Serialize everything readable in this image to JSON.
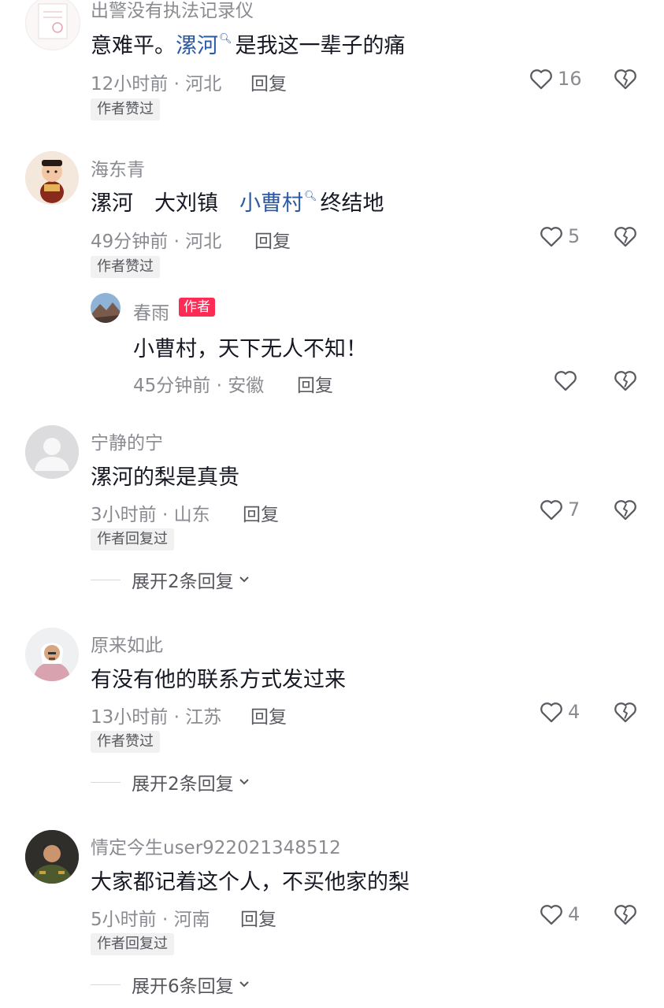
{
  "comments": [
    {
      "username": "出警没有执法记录仪",
      "text_parts": [
        "意难平。",
        "漯河",
        "是我这一辈子的痛"
      ],
      "time_location": "12小时前 · 河北",
      "reply_label": "回复",
      "likes": "16",
      "badge": "作者赞过"
    },
    {
      "username": "海东青",
      "text_parts": [
        "漯河　大刘镇　",
        "小曹村",
        "终结地"
      ],
      "time_location": "49分钟前 · 河北",
      "reply_label": "回复",
      "likes": "5",
      "badge": "作者赞过",
      "reply": {
        "username": "春雨",
        "author_tag": "作者",
        "text": "小曹村，天下无人不知！",
        "time_location": "45分钟前 · 安徽",
        "reply_label": "回复",
        "likes": ""
      }
    },
    {
      "username": "宁静的宁",
      "text": "漯河的梨是真贵",
      "time_location": "3小时前 · 山东",
      "reply_label": "回复",
      "likes": "7",
      "badge": "作者回复过",
      "expand_label": "展开2条回复"
    },
    {
      "username": "原来如此",
      "text": "有没有他的联系方式发过来",
      "time_location": "13小时前 · 江苏",
      "reply_label": "回复",
      "likes": "4",
      "badge": "作者赞过",
      "expand_label": "展开2条回复"
    },
    {
      "username": "情定今生user922021348512",
      "text": "大家都记着这个人，不买他家的梨",
      "time_location": "5小时前 · 河南",
      "reply_label": "回复",
      "likes": "4",
      "badge": "作者回复过",
      "expand_label": "展开6条回复"
    }
  ],
  "icons": {
    "like": "heart-outline-icon",
    "dislike": "broken-heart-icon",
    "expand": "chevron-down-icon",
    "link_search": "search-icon"
  },
  "colors": {
    "link": "#2b5aa5",
    "author_tag": "#fe2c55",
    "secondary_text": "#8a8b91"
  }
}
